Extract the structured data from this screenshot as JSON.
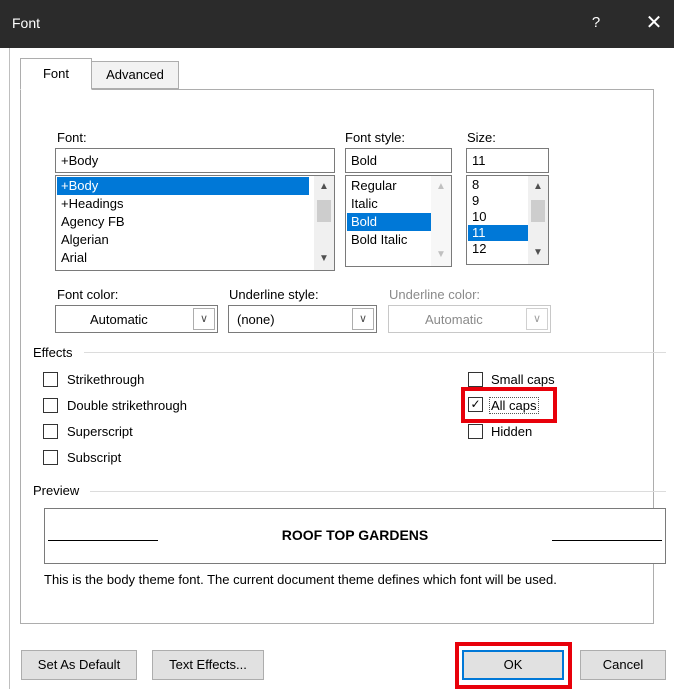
{
  "window": {
    "title": "Font",
    "help_label": "?",
    "close_label": "✕"
  },
  "tabs": {
    "font": "Font",
    "advanced": "Advanced"
  },
  "font_list": {
    "label": "Font:",
    "value": "+Body",
    "items": [
      "+Body",
      "+Headings",
      "Agency FB",
      "Algerian",
      "Arial"
    ],
    "selected_index": 0
  },
  "style_list": {
    "label": "Font style:",
    "value": "Bold",
    "items": [
      "Regular",
      "Italic",
      "Bold",
      "Bold Italic"
    ],
    "selected_index": 2
  },
  "size_list": {
    "label": "Size:",
    "value": "11",
    "items": [
      "8",
      "9",
      "10",
      "11",
      "12"
    ],
    "selected_index": 3
  },
  "font_color": {
    "label": "Font color:",
    "value": "Automatic"
  },
  "underline_style": {
    "label": "Underline style:",
    "value": "(none)"
  },
  "underline_color": {
    "label": "Underline color:",
    "value": "Automatic"
  },
  "effects": {
    "label": "Effects",
    "strikethrough": {
      "label": "Strikethrough",
      "checked": false
    },
    "double_strikethrough": {
      "label": "Double strikethrough",
      "checked": false
    },
    "superscript": {
      "label": "Superscript",
      "checked": false
    },
    "subscript": {
      "label": "Subscript",
      "checked": false
    },
    "small_caps": {
      "label": "Small caps",
      "checked": false
    },
    "all_caps": {
      "label": "All caps",
      "checked": true
    },
    "hidden": {
      "label": "Hidden",
      "checked": false
    }
  },
  "preview": {
    "label": "Preview",
    "sample_text": "ROOF TOP GARDENS",
    "description": "This is the body theme font. The current document theme defines which font will be used."
  },
  "buttons": {
    "set_default": "Set As Default",
    "text_effects": "Text Effects...",
    "ok": "OK",
    "cancel": "Cancel"
  },
  "colors": {
    "titlebar": "#2b2b2b",
    "selection": "#0078d7",
    "highlight": "#e8000a"
  }
}
